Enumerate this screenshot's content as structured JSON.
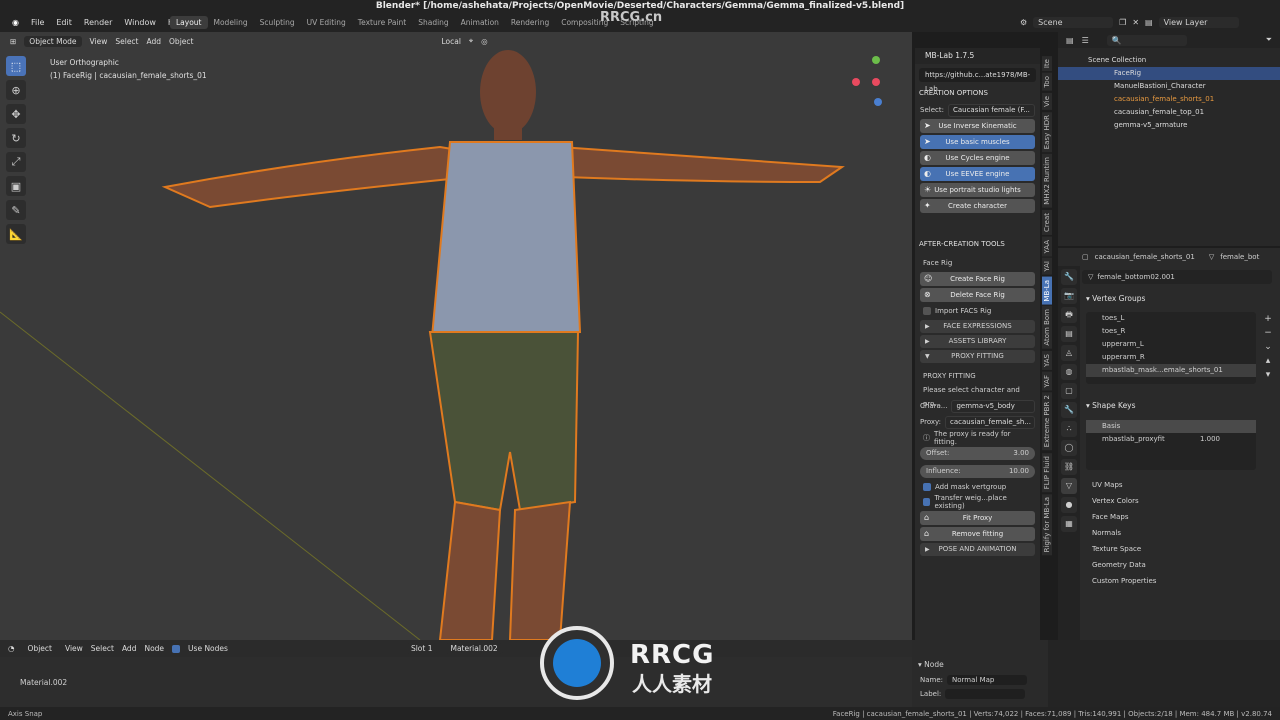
{
  "window": {
    "title": "Blender* [/home/ashehata/Projects/OpenMovie/Deserted/Characters/Gemma/Gemma_finalized-v5.blend]"
  },
  "menu": [
    "File",
    "Edit",
    "Render",
    "Window",
    "Help"
  ],
  "workspaces": [
    "Layout",
    "Modeling",
    "Sculpting",
    "UV Editing",
    "Texture Paint",
    "Shading",
    "Animation",
    "Rendering",
    "Compositing",
    "Scripting"
  ],
  "active_workspace": "Layout",
  "scene": {
    "name": "Scene",
    "view_layer": "View Layer"
  },
  "viewport": {
    "mode": "Object Mode",
    "menus": [
      "View",
      "Select",
      "Add",
      "Object"
    ],
    "orientation": "Local",
    "info_line1": "User Orthographic",
    "info_line2": "(1) FaceRig | cacausian_female_shorts_01"
  },
  "tools": [
    "select-icon",
    "cursor-icon",
    "move-icon",
    "rotate-icon",
    "scale-icon",
    "transform-icon",
    "annotate-icon",
    "measure-icon"
  ],
  "npanel": {
    "title": "MB-Lab 1.7.5",
    "url": "https://github.c...ate1978/MB-Lab",
    "creation_header": "CREATION OPTIONS",
    "select_label": "Select:",
    "select_value": "Caucasian female (F...",
    "buttons_creation": [
      {
        "label": "Use Inverse Kinematic",
        "active": false
      },
      {
        "label": "Use basic muscles",
        "active": true
      },
      {
        "label": "Use Cycles engine",
        "active": false
      },
      {
        "label": "Use EEVEE engine",
        "active": true
      },
      {
        "label": "Use portrait studio lights",
        "active": false
      },
      {
        "label": "Create character",
        "active": false
      }
    ],
    "after_header": "AFTER-CREATION TOOLS",
    "face_rig_label": "Face Rig",
    "create_face_rig": "Create Face Rig",
    "delete_face_rig": "Delete Face Rig",
    "import_facs": "Import FACS Rig",
    "folds": [
      "FACE EXPRESSIONS",
      "ASSETS LIBRARY",
      "PROXY FITTING"
    ],
    "proxy_header": "PROXY FITTING",
    "proxy_msg": "Please select character and pro...",
    "chara_label": "Chara...",
    "chara_value": "gemma-v5_body",
    "proxy_label": "Proxy:",
    "proxy_value": "cacausian_female_sh...",
    "proxy_ready": "The proxy is ready for fitting.",
    "offset_label": "Offset:",
    "offset_value": "3.00",
    "influence_label": "Influence:",
    "influence_value": "10.00",
    "add_mask": "Add mask vertgroup",
    "transfer": "Transfer weig...place existing)",
    "fit_proxy": "Fit Proxy",
    "remove_fitting": "Remove fitting",
    "pose_anim": "POSE AND ANIMATION"
  },
  "side_tabs": [
    "Ite",
    "Too",
    "Vie",
    "Easy HDR",
    "MHX2 Runtim",
    "Creat",
    "YAA",
    "YAI",
    "MB-La",
    "Atom Bom",
    "YAS",
    "YAF",
    "Extreme PBR 2",
    "FLIP Fluid",
    "Rigify for MB-La"
  ],
  "active_side_tab": "MB-La",
  "outliner": {
    "root": "Scene Collection",
    "items": [
      {
        "label": "FaceRig",
        "indent": 1,
        "selected": true
      },
      {
        "label": "ManuelBastioni_Character",
        "indent": 1,
        "selected": false
      },
      {
        "label": "cacausian_female_shorts_01",
        "indent": 2,
        "selected": false
      },
      {
        "label": "cacausian_female_top_01",
        "indent": 2,
        "selected": false
      },
      {
        "label": "gemma-v5_armature",
        "indent": 2,
        "selected": false
      }
    ]
  },
  "properties": {
    "object": "cacausian_female_shorts_01",
    "mesh_short": "female_bot",
    "mesh_data": "female_bottom02.001",
    "vertex_groups_header": "Vertex Groups",
    "vertex_groups": [
      "toes_L",
      "toes_R",
      "upperarm_L",
      "upperarm_R",
      "mbastlab_mask...emale_shorts_01"
    ],
    "shape_keys_header": "Shape Keys",
    "shape_keys": [
      {
        "name": "Basis",
        "value": ""
      },
      {
        "name": "mbastlab_proxyfit",
        "value": "1.000"
      }
    ],
    "subsections": [
      "UV Maps",
      "Vertex Colors",
      "Face Maps",
      "Normals",
      "Texture Space",
      "Geometry Data",
      "Custom Properties"
    ]
  },
  "node_editor": {
    "mode": "Object",
    "menus": [
      "View",
      "Select",
      "Add",
      "Node"
    ],
    "use_nodes": "Use Nodes",
    "slot": "Slot 1",
    "material": "Material.002",
    "material_label": "Material.002"
  },
  "node_panel": {
    "header": "Node",
    "name_label": "Name:",
    "name_value": "Normal Map",
    "label_label": "Label:"
  },
  "status": {
    "left": "Axis Snap",
    "right": "FaceRig | cacausian_female_shorts_01 | Verts:74,022 | Faces:71,089 | Tris:140,991 | Objects:2/18 | Mem: 484.7 MB | v2.80.74"
  },
  "watermark": {
    "top": "RRCG.cn",
    "brand": "RRCG",
    "sub": "人人素材"
  },
  "colors": {
    "accent": "#4772b3",
    "selection": "#334d80",
    "outline": "#e07a1f",
    "background": "#3a3a3a"
  }
}
